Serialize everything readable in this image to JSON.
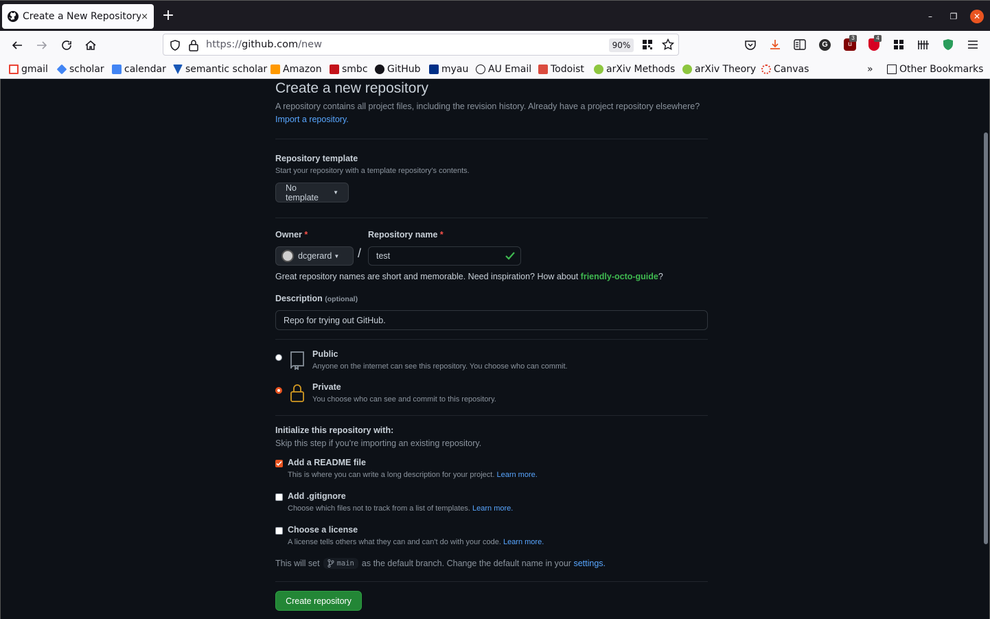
{
  "browser": {
    "tab_title": "Create a New Repository",
    "tab_close": "×",
    "new_tab": "+",
    "url_prefix": "https://",
    "url_host": "github.com",
    "url_path": "/new",
    "zoom": "90%",
    "bookmarks": [
      "gmail",
      "scholar",
      "calendar",
      "semantic scholar",
      "Amazon",
      "smbc",
      "GitHub",
      "myau",
      "AU Email",
      "Todoist",
      "arXiv Methods",
      "arXiv Theory",
      "Canvas"
    ],
    "other_bookmarks": "Other Bookmarks",
    "badges": [
      "3",
      "4"
    ]
  },
  "page": {
    "title": "Create a new repository",
    "intro": "A repository contains all project files, including the revision history. Already have a project repository elsewhere?",
    "import_link": "Import a repository.",
    "template_heading": "Repository template",
    "template_sub": "Start your repository with a template repository's contents.",
    "template_button": "No template",
    "owner_label": "Owner",
    "required_mark": "*",
    "repo_name_label": "Repository name",
    "owner_value": "dcgerard",
    "slash": "/",
    "repo_name_value": "test",
    "hint_prefix": "Great repository names are short and memorable. Need inspiration? How about ",
    "hint_suggestion": "friendly-octo-guide",
    "hint_suffix": "?",
    "description_label": "Description",
    "description_optional": "(optional)",
    "description_value": "Repo for trying out GitHub.",
    "visibility": [
      {
        "label": "Public",
        "sub": "Anyone on the internet can see this repository. You choose who can commit.",
        "selected": false
      },
      {
        "label": "Private",
        "sub": "You choose who can see and commit to this repository.",
        "selected": true
      }
    ],
    "init_heading": "Initialize this repository with:",
    "init_sub": "Skip this step if you're importing an existing repository.",
    "options": [
      {
        "label": "Add a README file",
        "sub": "This is where you can write a long description for your project.",
        "link": "Learn more.",
        "checked": true
      },
      {
        "label": "Add .gitignore",
        "sub": "Choose which files not to track from a list of templates.",
        "link": "Learn more.",
        "checked": false
      },
      {
        "label": "Choose a license",
        "sub": "A license tells others what they can and can't do with your code.",
        "link": "Learn more.",
        "checked": false
      }
    ],
    "branch_prefix": "This will set",
    "branch_name": "main",
    "branch_middle": "as the default branch. Change the default name in your",
    "settings_link": "settings.",
    "create_button": "Create repository"
  },
  "colors": {
    "accent": "#e95420",
    "primary_button": "#238636",
    "link": "#58a6ff",
    "suggestion": "#3fb950"
  }
}
